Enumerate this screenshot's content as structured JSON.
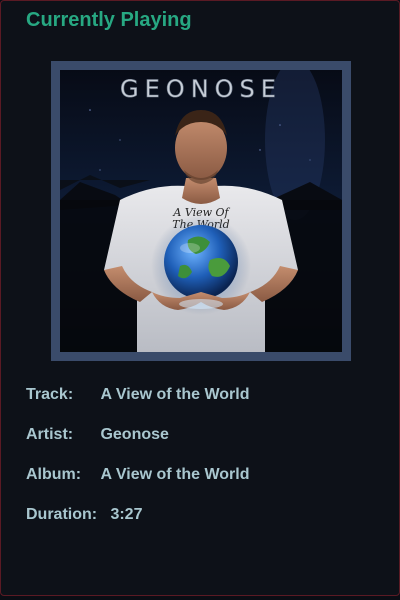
{
  "header": {
    "title": "Currently Playing"
  },
  "album_art": {
    "artist_logo_text": "GEONOSE",
    "shirt_text_line1": "A View Of",
    "shirt_text_line2": "The World",
    "description": "cover-image"
  },
  "track_info": {
    "track_label": "Track:",
    "track_value": "A View of the World",
    "artist_label": "Artist:",
    "artist_value": "Geonose",
    "album_label": "Album:",
    "album_value": "A View of the World",
    "duration_label": "Duration:",
    "duration_value": "3:27"
  },
  "colors": {
    "background": "#0d1118",
    "accent": "#27a882",
    "text": "#a9c7cf",
    "frame": "#3a4b6a"
  }
}
